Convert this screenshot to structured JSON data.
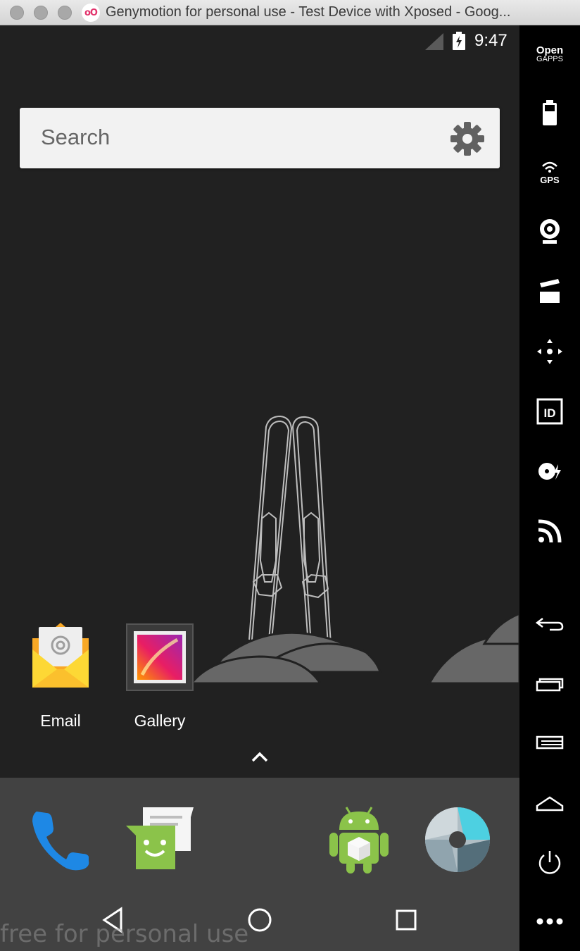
{
  "window": {
    "title": "Genymotion for personal use - Test Device with Xposed - Goog...",
    "logo_text": "oO"
  },
  "status_bar": {
    "time": "9:47"
  },
  "search": {
    "placeholder": "Search"
  },
  "home_apps": [
    {
      "label": "Email",
      "icon": "email-icon"
    },
    {
      "label": "Gallery",
      "icon": "gallery-icon"
    }
  ],
  "dock_apps": [
    "phone-icon",
    "messenger-icon",
    "android-cube-icon",
    "camera-shutter-icon"
  ],
  "nav_buttons": [
    "back-icon",
    "home-icon",
    "recents-icon"
  ],
  "watermark": "free for personal use",
  "sidebar": {
    "open_gapps_line1": "Open",
    "open_gapps_line2": "GAPPS",
    "gps_label": "GPS",
    "id_label": "ID",
    "buttons": [
      "battery-icon",
      "gps-icon",
      "webcam-icon",
      "screencast-icon",
      "dpad-icon",
      "device-id-icon",
      "disk-io-icon",
      "network-icon",
      "back-icon",
      "recent-apps-icon",
      "menu-icon",
      "home-icon",
      "power-icon",
      "more-icon"
    ]
  },
  "colors": {
    "screen_bg": "#212121",
    "dock_bg": "#424242",
    "sidebar_bg": "#000000",
    "email_yellow": "#fdd835",
    "phone_blue": "#1e88e5",
    "messenger_green": "#8bc34a",
    "android_green": "#8bc34a"
  }
}
